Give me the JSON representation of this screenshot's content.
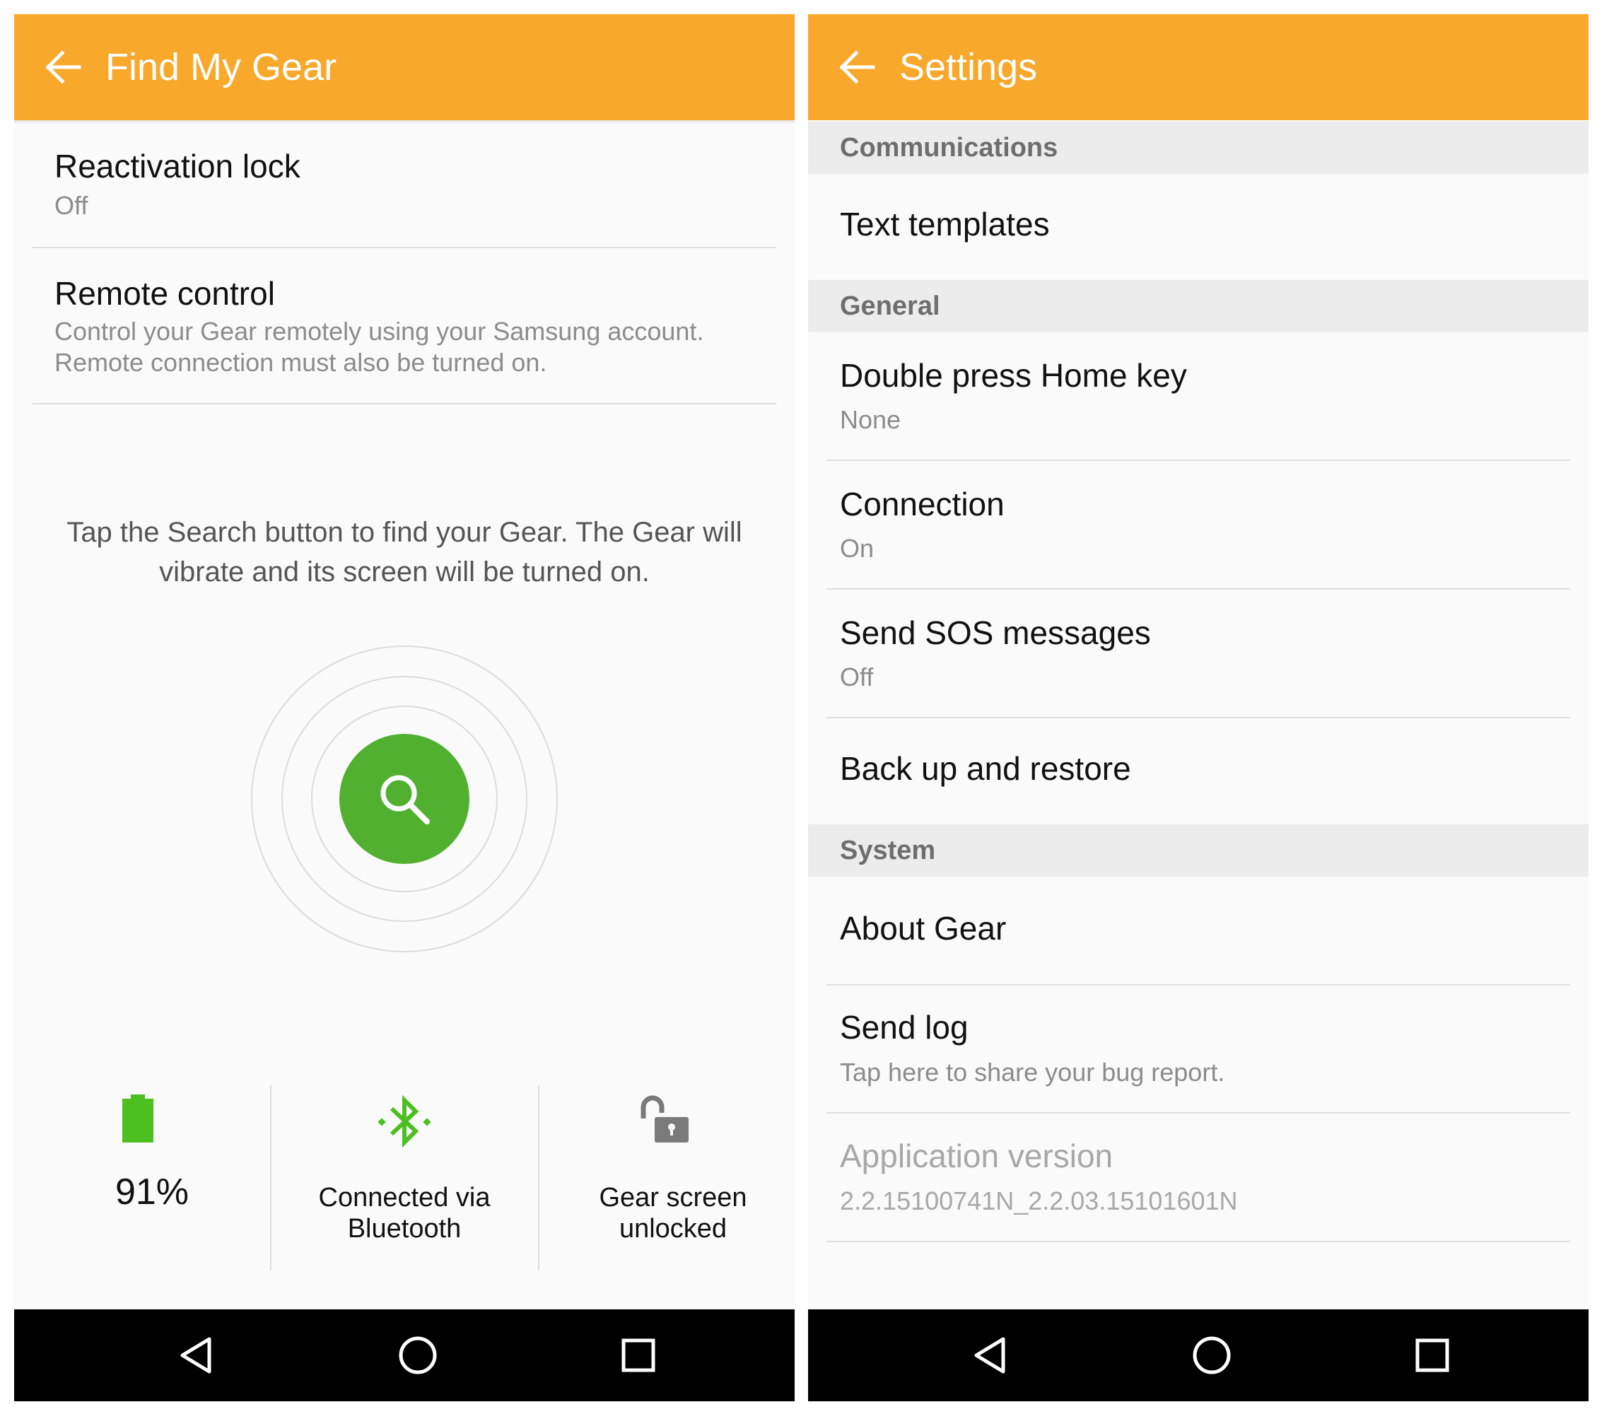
{
  "colors": {
    "accent": "#f8a82a",
    "search_green": "#52b031",
    "battery_green": "#4cc020",
    "navbar": "#000000"
  },
  "find_my_gear": {
    "title": "Find My Gear",
    "reactivation_lock": {
      "title": "Reactivation lock",
      "value": "Off"
    },
    "remote_control": {
      "title": "Remote control",
      "description_line1": "Control your Gear remotely using your Samsung account.",
      "description_line2": "Remote connection must also be turned on."
    },
    "hint_line1": "Tap the Search button to find your Gear. The Gear will",
    "hint_line2": "vibrate and its screen will be turned on.",
    "search_icon": "search-icon",
    "status": {
      "battery": {
        "icon": "battery-icon",
        "value": "91%"
      },
      "connection": {
        "icon": "bluetooth-icon",
        "line1": "Connected via",
        "line2": "Bluetooth"
      },
      "screen": {
        "icon": "unlocked-icon",
        "line1": "Gear screen",
        "line2": "unlocked"
      }
    }
  },
  "settings": {
    "title": "Settings",
    "sections": {
      "communications": "Communications",
      "general": "General",
      "system": "System"
    },
    "items": {
      "text_templates": {
        "title": "Text templates"
      },
      "double_press": {
        "title": "Double press Home key",
        "value": "None"
      },
      "connection": {
        "title": "Connection",
        "value": "On"
      },
      "send_sos": {
        "title": "Send SOS messages",
        "value": "Off"
      },
      "backup_restore": {
        "title": "Back up and restore"
      },
      "about_gear": {
        "title": "About Gear"
      },
      "send_log": {
        "title": "Send log",
        "description": "Tap here to share your bug report."
      },
      "app_version": {
        "title": "Application version",
        "value": "2.2.15100741N_2.2.03.15101601N"
      }
    }
  },
  "navbar_icons": [
    "back-icon",
    "home-icon",
    "recents-icon"
  ]
}
